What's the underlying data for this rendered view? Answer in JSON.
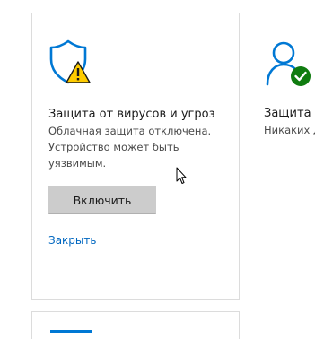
{
  "virus_card": {
    "icon": "shield-warning-icon",
    "title": "Защита от вирусов и угроз",
    "description": "Облачная защита отключена. Устройство может быть уязвимым.",
    "enable_button": "Включить",
    "dismiss_link": "Закрыть"
  },
  "account_card": {
    "icon": "account-check-icon",
    "title": "Защита у",
    "description": "Никаких д"
  },
  "colors": {
    "accent": "#0078d4",
    "warning": "#ffcc00",
    "ok": "#107c10",
    "link": "#0067c0"
  }
}
